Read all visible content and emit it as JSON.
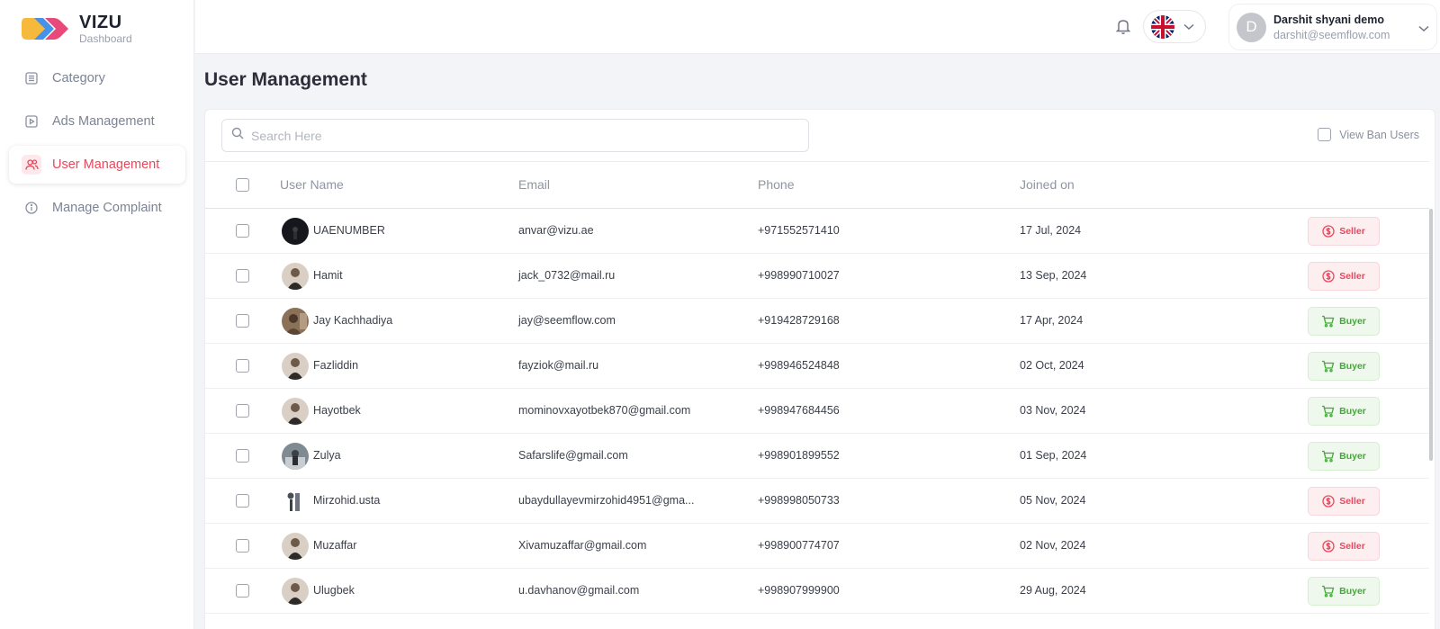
{
  "brand": {
    "title": "VIZU",
    "subtitle": "Dashboard"
  },
  "sidebar": {
    "items": [
      {
        "label": "Category",
        "icon": "list-icon",
        "active": false
      },
      {
        "label": "Ads Management",
        "icon": "play-square-icon",
        "active": false
      },
      {
        "label": "User Management",
        "icon": "users-icon",
        "active": true
      },
      {
        "label": "Manage Complaint",
        "icon": "info-circle-icon",
        "active": false
      }
    ]
  },
  "header": {
    "language_icon": "uk-flag-icon",
    "user": {
      "initial": "D",
      "name": "Darshit shyani demo",
      "email": "darshit@seemflow.com"
    }
  },
  "main": {
    "title": "User Management",
    "search": {
      "placeholder": "Search Here",
      "value": ""
    },
    "view_ban_users": "View Ban Users",
    "columns": {
      "user_name": "User Name",
      "email": "Email",
      "phone": "Phone",
      "joined_on": "Joined on"
    },
    "rows": [
      {
        "name": "UAENUMBER",
        "email": "anvar@vizu.ae",
        "phone": "+971552571410",
        "joined": "17 Jul, 2024",
        "role": "Seller"
      },
      {
        "name": "Hamit",
        "email": "jack_0732@mail.ru",
        "phone": "+998990710027",
        "joined": "13 Sep, 2024",
        "role": "Seller"
      },
      {
        "name": "Jay Kachhadiya",
        "email": "jay@seemflow.com",
        "phone": "+919428729168",
        "joined": "17 Apr, 2024",
        "role": "Buyer"
      },
      {
        "name": "Fazliddin",
        "email": "fayziok@mail.ru",
        "phone": "+998946524848",
        "joined": "02 Oct, 2024",
        "role": "Buyer"
      },
      {
        "name": "Hayotbek",
        "email": "mominovxayotbek870@gmail.com",
        "phone": "+998947684456",
        "joined": "03 Nov, 2024",
        "role": "Buyer"
      },
      {
        "name": "Zulya",
        "email": "Safarslife@gmail.com",
        "phone": "+998901899552",
        "joined": "01 Sep, 2024",
        "role": "Buyer"
      },
      {
        "name": "Mirzohid.usta",
        "email": "ubaydullayevmirzohid4951@gma...",
        "phone": "+998998050733",
        "joined": "05 Nov, 2024",
        "role": "Seller"
      },
      {
        "name": "Muzaffar",
        "email": "Xivamuzaffar@gmail.com",
        "phone": "+998900774707",
        "joined": "02 Nov, 2024",
        "role": "Seller"
      },
      {
        "name": "Ulugbek",
        "email": "u.davhanov@gmail.com",
        "phone": "+998907999900",
        "joined": "29 Aug, 2024",
        "role": "Buyer"
      }
    ]
  },
  "colors": {
    "accent": "#e8485c",
    "seller": "#e8485c",
    "buyer": "#43a83a",
    "logo_yellow": "#f6b93b",
    "logo_blue": "#3c8ce7",
    "logo_pink": "#e8487a"
  }
}
